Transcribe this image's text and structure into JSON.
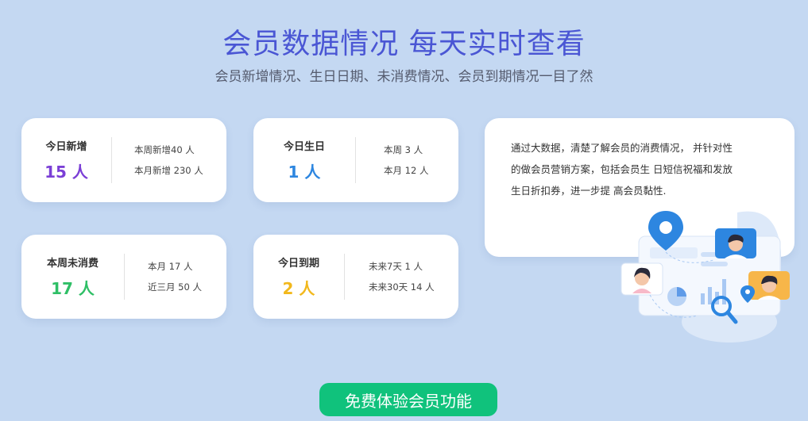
{
  "header": {
    "title": "会员数据情况  每天实时查看",
    "subtitle": "会员新增情况、生日日期、未消费情况、会员到期情况一目了然"
  },
  "cards": [
    {
      "label": "今日新增",
      "value": "15 人",
      "color": "#7b3fd6",
      "details": [
        "本周新增40 人",
        "本月新增 230 人"
      ]
    },
    {
      "label": "今日生日",
      "value": "1 人",
      "color": "#2d86e0",
      "details": [
        "本周 3 人",
        "本月 12 人"
      ]
    },
    {
      "label": "本周未消费",
      "value": "17 人",
      "color": "#2fbf66",
      "details": [
        "本月 17 人",
        "近三月 50 人"
      ]
    },
    {
      "label": "今日到期",
      "value": "2 人",
      "color": "#f2b81c",
      "details": [
        "未来7天 1 人",
        "未来30天 14 人"
      ]
    }
  ],
  "description": {
    "line1": "通过大数据，清楚了解会员的消费情况， 并针对性",
    "line2": "的做会员营销方案，包括会员生 日短信祝福和发放",
    "line3": "生日折扣券，进一步提 高会员黏性."
  },
  "cta": {
    "label": "免费体验会员功能",
    "color": "#10c27c"
  },
  "icons": [
    "location-pin-icon",
    "magnifier-icon",
    "avatar-icon",
    "chart-icon"
  ]
}
